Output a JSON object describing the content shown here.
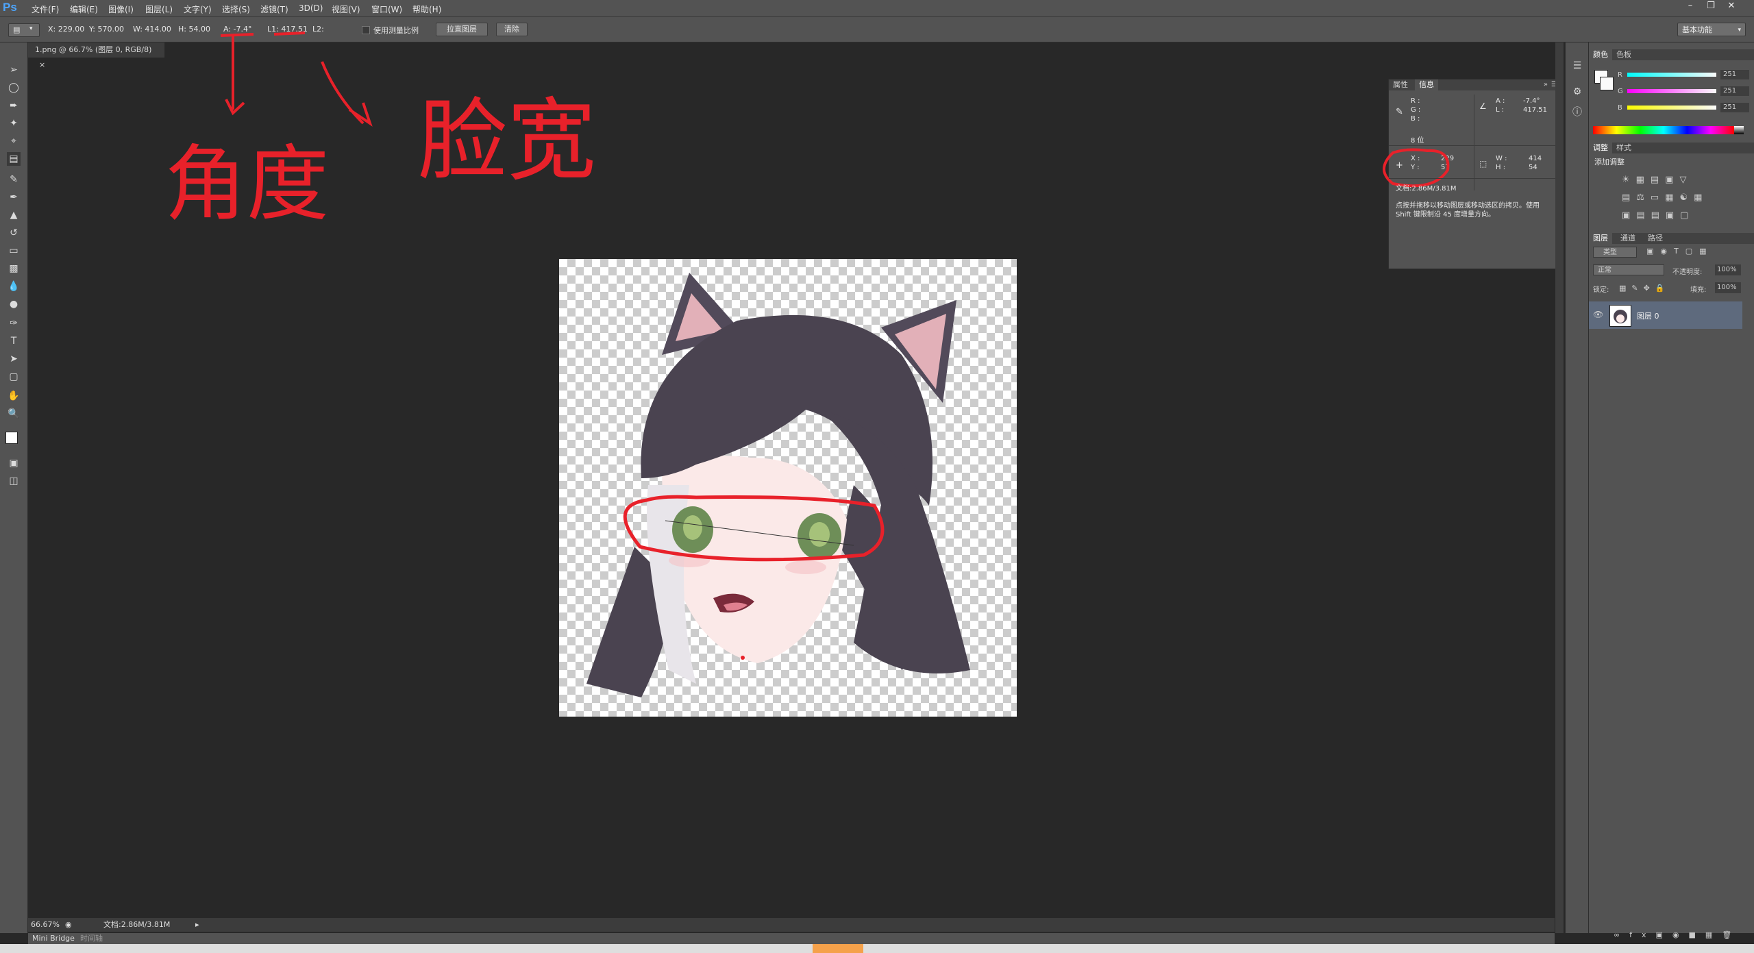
{
  "menubar": {
    "logo": "Ps",
    "items": [
      "文件(F)",
      "编辑(E)",
      "图像(I)",
      "图层(L)",
      "文字(Y)",
      "选择(S)",
      "滤镜(T)",
      "3D(D)",
      "视图(V)",
      "窗口(W)",
      "帮助(H)"
    ]
  },
  "options": {
    "x": "X: 229.00",
    "y": "Y: 570.00",
    "w": "W: 414.00",
    "h": "H: 54.00",
    "a": "A: -7.4°",
    "l1": "L1: 417.51",
    "l2": "L2:",
    "use_scale_label": "使用测量比例",
    "straighten_label": "拉直图层",
    "clear_label": "清除",
    "workspace": "基本功能"
  },
  "document": {
    "tab_title": "1.png @ 66.7% (图层 0, RGB/8)",
    "zoom": "66.67%",
    "doc_size": "文档:2.86M/3.81M",
    "bottom_tabs": [
      "Mini Bridge",
      "时间轴"
    ]
  },
  "info_panel": {
    "tabs": [
      "属性",
      "信息"
    ],
    "r": "R :",
    "g": "G :",
    "b": "B :",
    "bit": "8 位",
    "a_label": "A :",
    "a_value": "-7.4°",
    "l_label": "L :",
    "l_value": "417.51",
    "x_label": "X :",
    "x_value": "229",
    "y_label": "Y :",
    "y_value": "57",
    "w_label": "W :",
    "w_value": "414",
    "h_label": "H :",
    "h_value": "54",
    "doc": "文档:2.86M/3.81M",
    "hint": "点按并拖移以移动图层或移动选区的拷贝。使用 Shift 键限制沿 45 度增量方向。"
  },
  "color_panel": {
    "tabs": [
      "颜色",
      "色板"
    ],
    "r_label": "R",
    "r_value": "251",
    "g_label": "G",
    "g_value": "251",
    "b_label": "B",
    "b_value": "251"
  },
  "adjust_panel": {
    "tabs": [
      "调整",
      "样式"
    ],
    "title": "添加调整"
  },
  "layers_panel": {
    "tabs": [
      "图层",
      "通道",
      "路径"
    ],
    "filter": "类型",
    "blend": "正常",
    "opacity_label": "不透明度:",
    "opacity": "100%",
    "lock_label": "锁定:",
    "fill_label": "填充:",
    "fill": "100%",
    "layer_name": "图层 0"
  },
  "annotations": {
    "angle": "角度",
    "face_width": "脸宽"
  },
  "colors": {
    "ui_bg": "#535353",
    "canvas_bg": "#282828",
    "annotation_red": "#e8212a",
    "ps_blue": "#4da6ff"
  }
}
